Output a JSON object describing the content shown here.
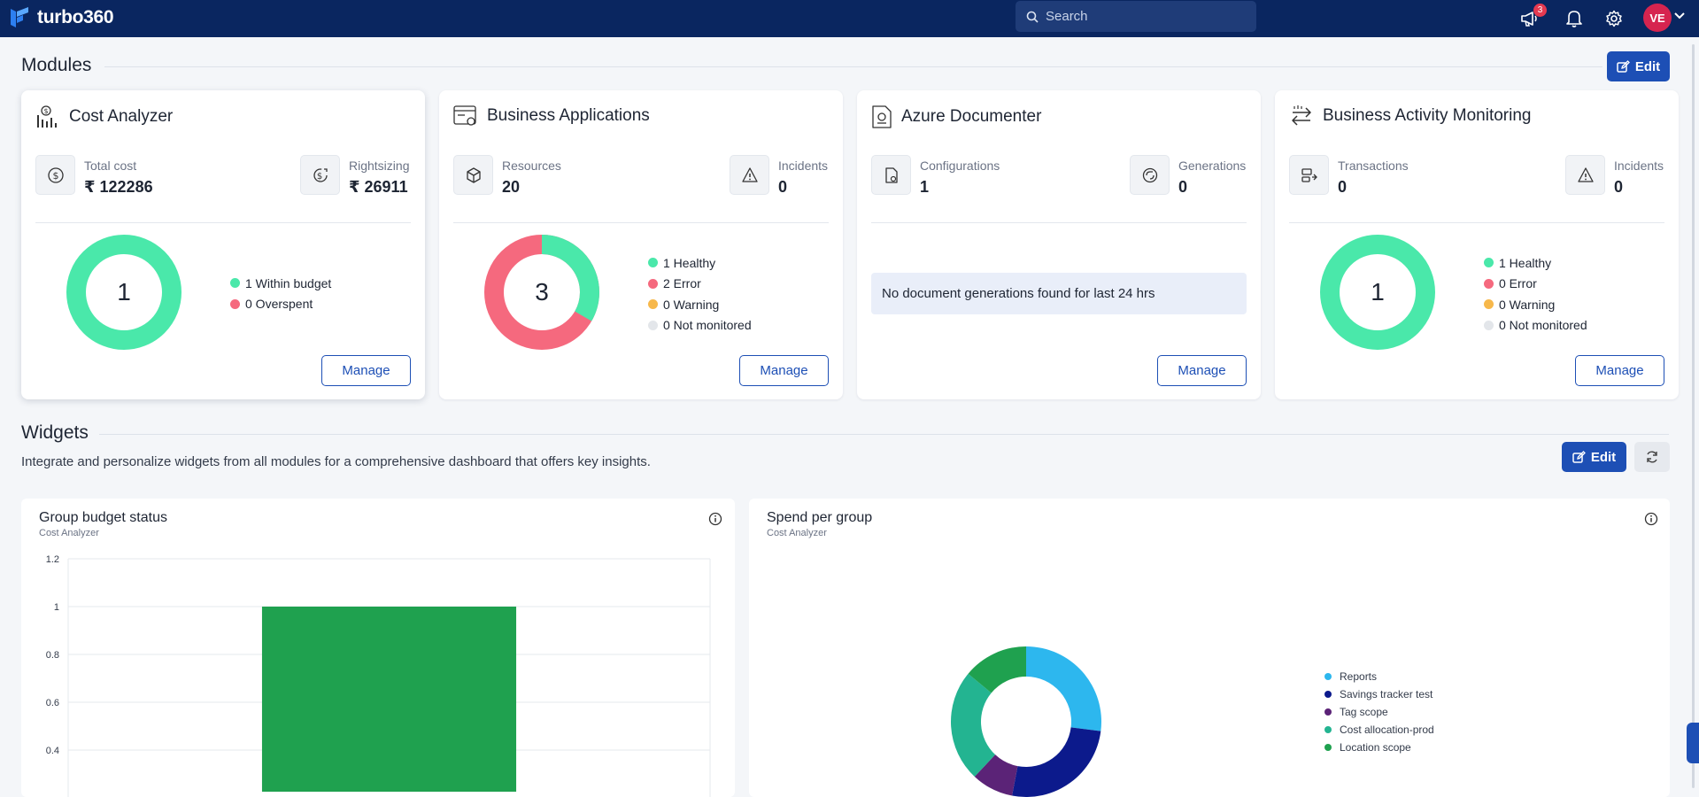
{
  "app": {
    "name": "turbo360"
  },
  "search": {
    "placeholder": "Search"
  },
  "topbar": {
    "notification_count": "3",
    "avatar_initials": "VE"
  },
  "modules": {
    "title": "Modules",
    "edit_label": "Edit",
    "manage_label": "Manage",
    "cards": [
      {
        "title": "Cost Analyzer",
        "stats": [
          {
            "label": "Total cost",
            "value": "₹ 122286",
            "icon": "dollar-circle-icon"
          },
          {
            "label": "Rightsizing",
            "value": "₹ 26911",
            "icon": "rightsizing-icon"
          }
        ],
        "donut_total": "1",
        "legend": [
          {
            "label": "1 Within budget",
            "color": "#4ae8aa",
            "value": 1
          },
          {
            "label": "0 Overspent",
            "color": "#f5697e",
            "value": 0
          }
        ]
      },
      {
        "title": "Business Applications",
        "stats": [
          {
            "label": "Resources",
            "value": "20",
            "icon": "cube-icon"
          },
          {
            "label": "Incidents",
            "value": "0",
            "icon": "warning-icon"
          }
        ],
        "donut_total": "3",
        "legend": [
          {
            "label": "1 Healthy",
            "color": "#4ae8aa",
            "value": 1
          },
          {
            "label": "2 Error",
            "color": "#f5697e",
            "value": 2
          },
          {
            "label": "0 Warning",
            "color": "#f7b84b",
            "value": 0
          },
          {
            "label": "0 Not monitored",
            "color": "#e3e6ea",
            "value": 0
          }
        ]
      },
      {
        "title": "Azure Documenter",
        "stats": [
          {
            "label": "Configurations",
            "value": "1",
            "icon": "document-gear-icon"
          },
          {
            "label": "Generations",
            "value": "0",
            "icon": "generations-icon"
          }
        ],
        "message": "No document generations found for last 24 hrs"
      },
      {
        "title": "Business Activity Monitoring",
        "stats": [
          {
            "label": "Transactions",
            "value": "0",
            "icon": "transactions-icon"
          },
          {
            "label": "Incidents",
            "value": "0",
            "icon": "warning-icon"
          }
        ],
        "donut_total": "1",
        "legend": [
          {
            "label": "1 Healthy",
            "color": "#4ae8aa",
            "value": 1
          },
          {
            "label": "0 Error",
            "color": "#f5697e",
            "value": 0
          },
          {
            "label": "0 Warning",
            "color": "#f7b84b",
            "value": 0
          },
          {
            "label": "0 Not monitored",
            "color": "#e3e6ea",
            "value": 0
          }
        ]
      }
    ]
  },
  "widgets": {
    "title": "Widgets",
    "description": "Integrate and personalize widgets from all modules for a comprehensive dashboard that offers key insights.",
    "edit_label": "Edit",
    "items": [
      {
        "title": "Group budget status",
        "subtitle": "Cost Analyzer"
      },
      {
        "title": "Spend per group",
        "subtitle": "Cost Analyzer"
      }
    ]
  },
  "chart_data": [
    {
      "type": "bar",
      "title": "Group budget status",
      "subtitle": "Cost Analyzer",
      "categories": [
        ""
      ],
      "values": [
        1
      ],
      "bar_color": "#1fa14f",
      "ylim": [
        0,
        1.2
      ],
      "yticks": [
        "1.2",
        "1",
        "0.8",
        "0.6",
        "0.4"
      ],
      "grid": true
    },
    {
      "type": "pie",
      "title": "Spend per group",
      "subtitle": "Cost Analyzer",
      "donut": true,
      "series": [
        {
          "name": "Reports",
          "value": 27,
          "color": "#2db7ee"
        },
        {
          "name": "Savings tracker test",
          "value": 26,
          "color": "#0c1a8c"
        },
        {
          "name": "Tag scope",
          "value": 9,
          "color": "#5b2377"
        },
        {
          "name": "Cost allocation-prod",
          "value": 24,
          "color": "#23b491"
        },
        {
          "name": "Location scope",
          "value": 14,
          "color": "#1fa14f"
        }
      ],
      "legend_position": "right"
    }
  ]
}
